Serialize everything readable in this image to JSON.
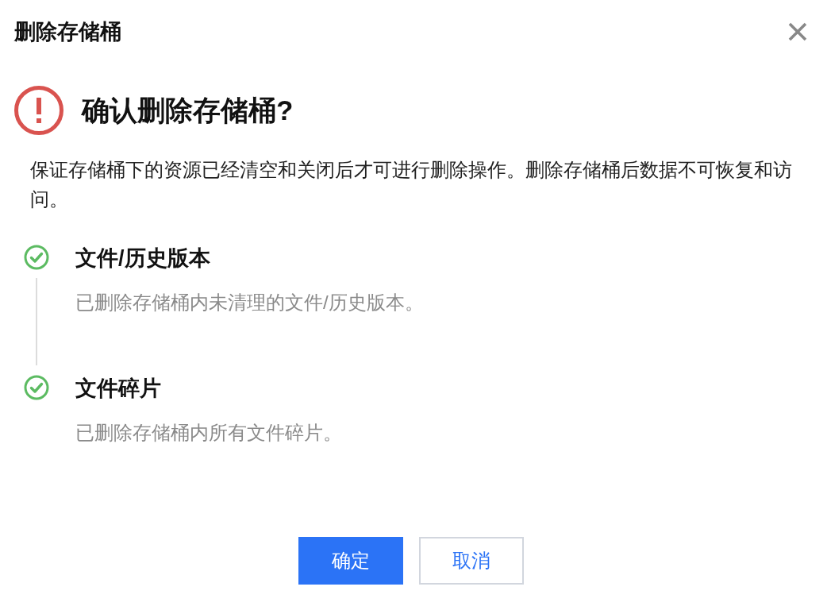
{
  "dialog": {
    "title": "删除存储桶",
    "heading": "确认删除存储桶?",
    "message": "保证存储桶下的资源已经清空和关闭后才可进行删除操作。删除存储桶后数据不可恢复和访问。",
    "steps": [
      {
        "title": "文件/历史版本",
        "description": "已删除存储桶内未清理的文件/历史版本。",
        "done": true
      },
      {
        "title": "文件碎片",
        "description": "已删除存储桶内所有文件碎片。",
        "done": true
      }
    ],
    "buttons": [
      {
        "label": "确定",
        "kind": "primary"
      },
      {
        "label": "取消",
        "kind": "secondary"
      }
    ]
  }
}
